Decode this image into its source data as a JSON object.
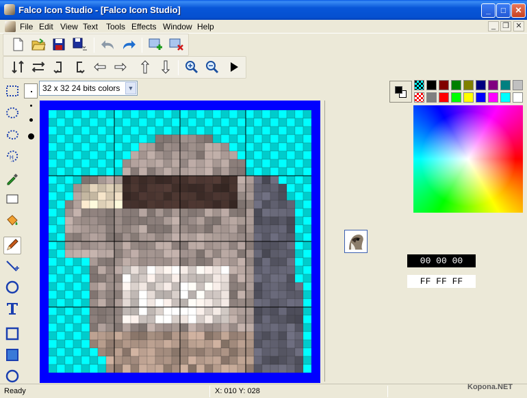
{
  "window": {
    "title": "Falco Icon Studio - [Falco Icon Studio]",
    "buttons": {
      "minimize": "_",
      "maximize": "□",
      "close": "✕"
    }
  },
  "menu": {
    "items": [
      "File",
      "Edit",
      "View",
      "Text",
      "Tools",
      "Effects",
      "Window",
      "Help"
    ],
    "mdi_buttons": {
      "minimize": "_",
      "restore": "❐",
      "close": "✕"
    }
  },
  "toolbar1": {
    "icons": [
      "new-icon",
      "open-icon",
      "save-icon",
      "save-all-icon",
      "undo-icon",
      "redo-icon",
      "add-image-icon",
      "delete-image-icon"
    ]
  },
  "toolbar2": {
    "icons": [
      "flip-vertical-icon",
      "flip-horizontal-icon",
      "rotate-left-icon",
      "rotate-right-icon",
      "shift-left-icon",
      "shift-right-icon",
      "shift-up-icon",
      "shift-down-icon",
      "zoom-in-icon",
      "zoom-out-icon",
      "play-icon"
    ]
  },
  "tools": {
    "items": [
      "rect-select-tool",
      "ellipse-select-tool",
      "lasso-select-tool",
      "magic-wand-tool",
      "color-picker-tool",
      "rectangle-tool",
      "fill-tool",
      "pencil-tool",
      "line-tool",
      "ellipse-tool",
      "text-tool",
      "rect-outline-tool",
      "rect-filled-tool",
      "ellipse-outline-tool"
    ],
    "active": "pencil-tool",
    "brush_sizes": [
      "small",
      "medium",
      "large"
    ]
  },
  "format": {
    "selected": "32 x 32 24 bits colors"
  },
  "colors": {
    "foreground_hex": "00 00 00",
    "background_hex": "FF FF FF",
    "palette_row1": [
      "#00ffff",
      "#000000",
      "#800000",
      "#008000",
      "#808000",
      "#000080",
      "#800080",
      "#008080",
      "#c0c0c0"
    ],
    "palette_row2": [
      "#ff0000",
      "#808080",
      "#ff0000",
      "#00ff00",
      "#ffff00",
      "#0000ff",
      "#ff00ff",
      "#00ffff",
      "#ffffff"
    ],
    "transparent": "#00ffff",
    "canvas_border": "#0000ff"
  },
  "status": {
    "message": "Ready",
    "coords": "X: 010 Y: 028",
    "watermark": "Kopona.NET"
  }
}
